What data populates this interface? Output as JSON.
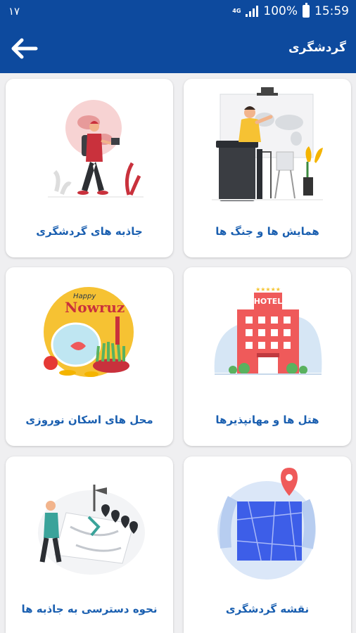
{
  "status_bar": {
    "left": "۱۷",
    "net": "4G",
    "battery": "100%",
    "time": "15:59"
  },
  "app_bar": {
    "title": "گردشگری",
    "back_icon": "arrow-left-icon"
  },
  "cards": [
    {
      "label": "همایش ها و جنگ ها",
      "icon": "presentation-illustration"
    },
    {
      "label": "جاذبه های گردشگری",
      "icon": "traveler-illustration"
    },
    {
      "label": "هتل ها و مهانپذیرها",
      "icon": "hotel-illustration"
    },
    {
      "label": "محل های اسکان نوروزی",
      "icon": "nowruz-illustration"
    },
    {
      "label": "نقشه گردشگری",
      "icon": "map-pin-illustration"
    },
    {
      "label": "نحوه دسترسی به جاذبه ها",
      "icon": "directions-illustration"
    }
  ],
  "illustration_text": {
    "happy": "Happy",
    "nowruz": "Nowruz",
    "hotel": "HOTEL"
  },
  "colors": {
    "primary": "#0d4a9e",
    "label": "#1a5fb0",
    "background": "#efeff1"
  }
}
